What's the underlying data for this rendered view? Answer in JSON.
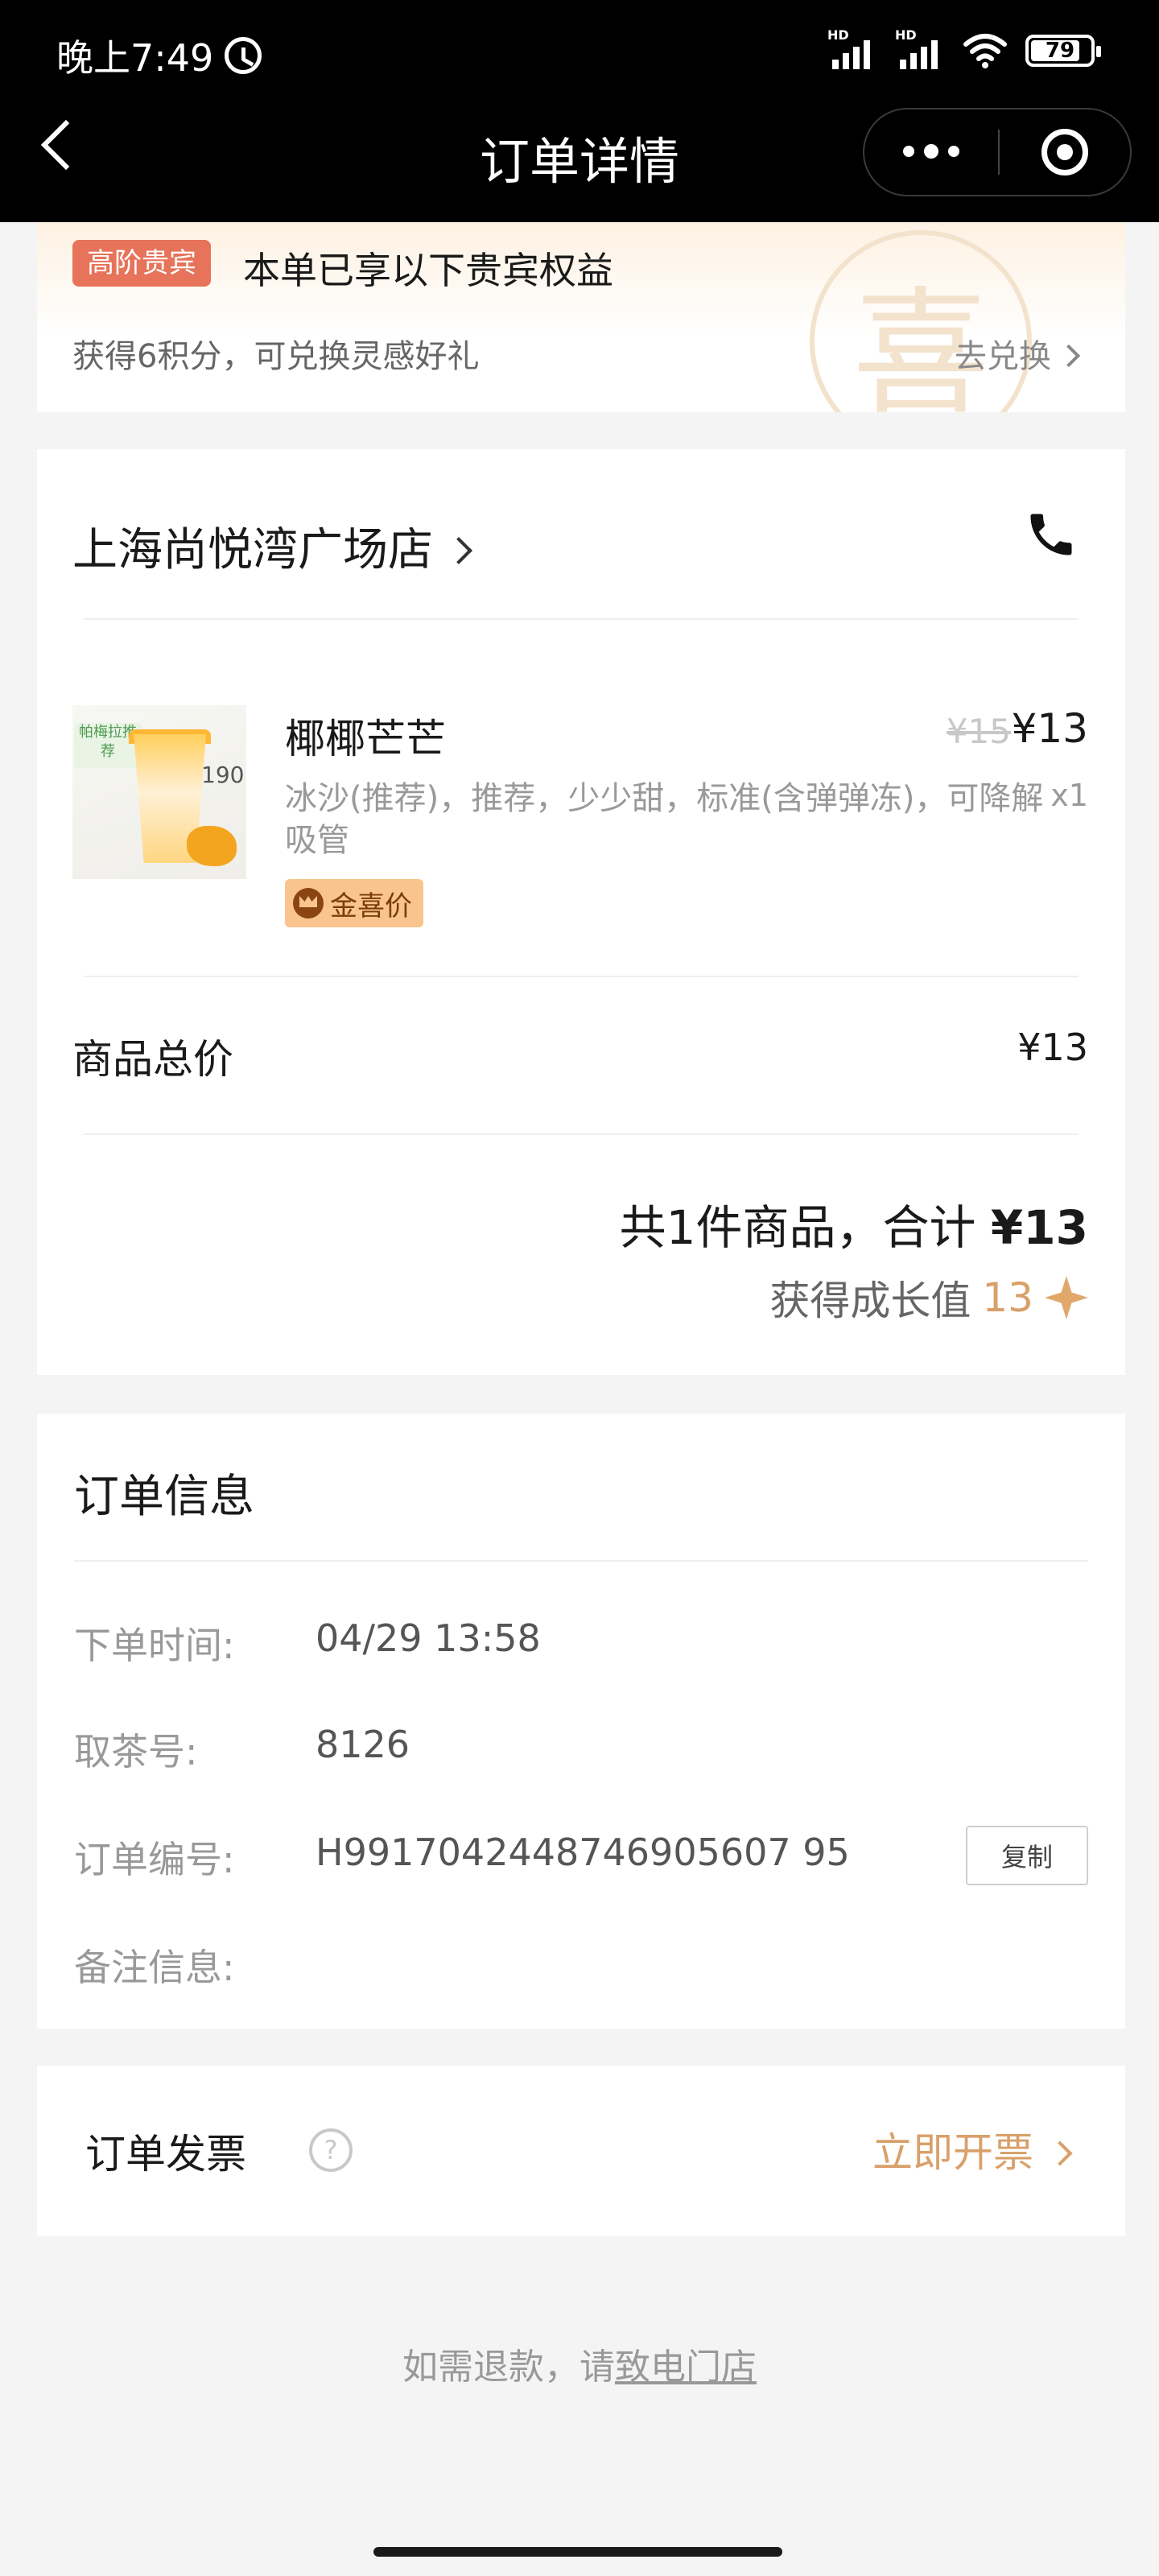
{
  "status_bar": {
    "time": "晚上7:49",
    "hd1": "HD",
    "hd2": "HD",
    "battery": "79"
  },
  "nav": {
    "title": "订单详情"
  },
  "vip": {
    "badge": "高阶贵宾",
    "title": "本单已享以下贵宾权益",
    "watermark": "喜",
    "desc": "获得6积分，可兑换灵感好礼",
    "link": "去兑换"
  },
  "order": {
    "store": "上海尚悦湾广场店",
    "item": {
      "image_tag": "帕梅拉推荐",
      "image_number": "190",
      "name": "椰椰芒芒",
      "spec": "冰沙(推荐)，推荐，少少甜，标准(含弹弹冻)，可降解吸管",
      "badge": "金喜价",
      "old_price": "¥15",
      "price": "¥13",
      "qty": "x1"
    },
    "subtotal_label": "商品总价",
    "subtotal_value": "¥13",
    "total_text": "共1件商品，合计",
    "total_value": "¥13",
    "growth_label": "获得成长值",
    "growth_value": "13"
  },
  "info": {
    "title": "订单信息",
    "rows": [
      {
        "key": "下单时间:",
        "value": "04/29 13:58"
      },
      {
        "key": "取茶号:",
        "value": "8126"
      },
      {
        "key": "订单编号:",
        "value": "H9917042448746905607 95"
      },
      {
        "key": "备注信息:",
        "value": ""
      }
    ],
    "copy_label": "复制"
  },
  "invoice": {
    "label": "订单发票",
    "help": "?",
    "link": "立即开票"
  },
  "refund": {
    "prefix": "如需退款，请",
    "call": "致电门店"
  },
  "colors": {
    "accent": "#d9a06a",
    "vip_badge": "#e6735a",
    "price_badge": "#f9c48d"
  }
}
